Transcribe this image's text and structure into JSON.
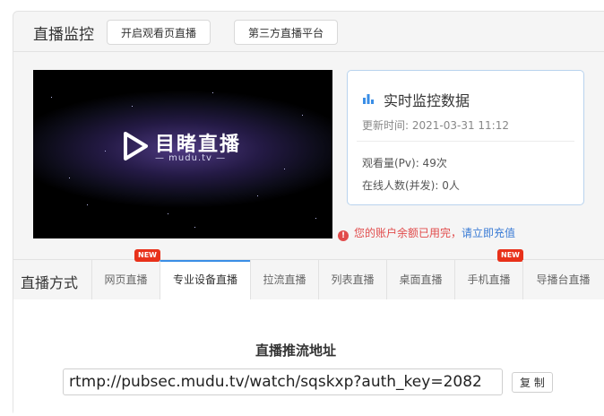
{
  "header": {
    "title": "直播监控",
    "buttons": [
      "开启观看页直播",
      "第三方直播平台"
    ]
  },
  "video": {
    "logo_text": "目睹直播",
    "logo_sub": "— mudu.tv —"
  },
  "stats": {
    "title": "实时监控数据",
    "updated": "更新时间: 2021-03-31 11:12",
    "views": "观看量(Pv):  49次",
    "online": "在线人数(并发):  0人"
  },
  "alert": {
    "icon": "alert-icon",
    "text": "您的账户余额已用完，",
    "link": "请立即充值"
  },
  "tabs": {
    "label": "直播方式",
    "items": [
      {
        "label": "网页直播",
        "badge": "NEW"
      },
      {
        "label": "专业设备直播",
        "badge": ""
      },
      {
        "label": "拉流直播",
        "badge": ""
      },
      {
        "label": "列表直播",
        "badge": ""
      },
      {
        "label": "桌面直播",
        "badge": ""
      },
      {
        "label": "手机直播",
        "badge": "NEW"
      },
      {
        "label": "导播台直播",
        "badge": ""
      }
    ],
    "active": "专业设备直播"
  },
  "push": {
    "title": "直播推流地址",
    "url": "rtmp://pubsec.mudu.tv/watch/sqskxp?auth_key=2082",
    "copy_label": "复 制"
  },
  "colors": {
    "accent": "#3a8ee6",
    "badge": "#e8311a",
    "alert": "#e14b4b",
    "link": "#3a7bd5"
  }
}
